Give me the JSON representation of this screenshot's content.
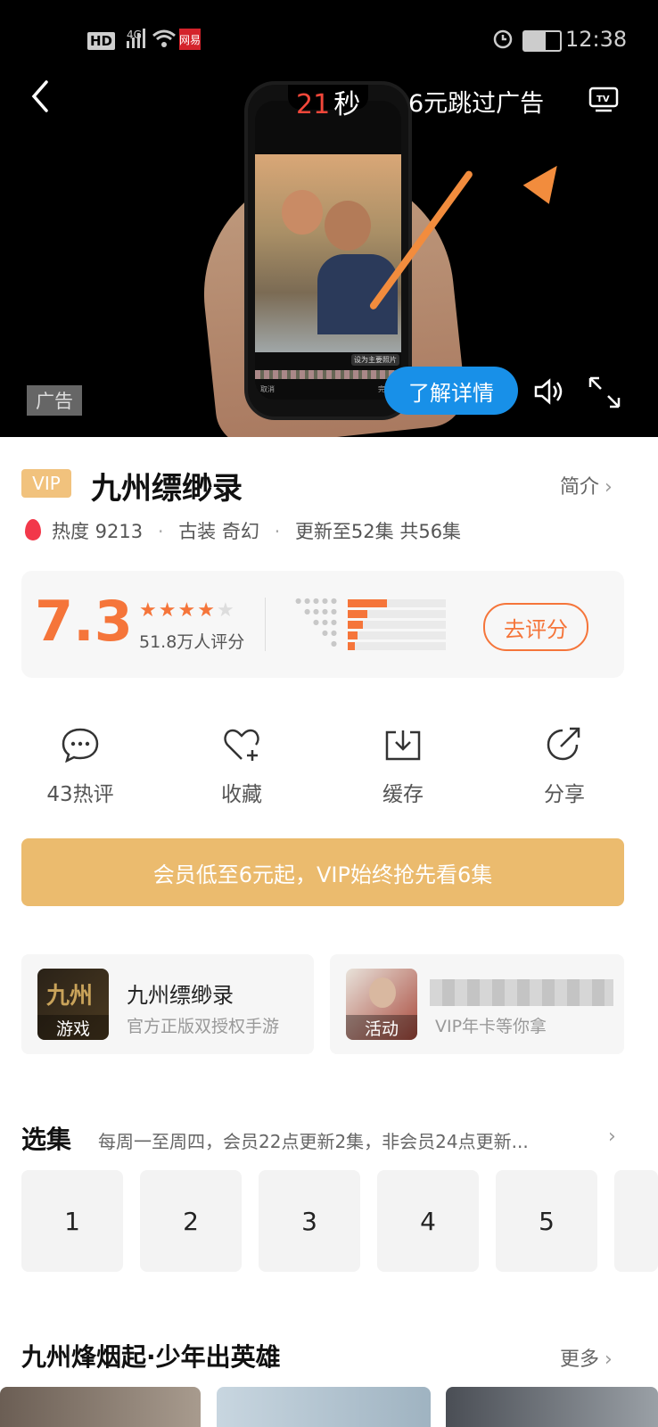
{
  "status_bar": {
    "network": "HD",
    "signal": "4G",
    "carrier_badge": "网易",
    "time": "12:38"
  },
  "ad": {
    "countdown_number": "21",
    "countdown_unit": "秒",
    "skip_text": "6元跳过广告",
    "tag": "广告",
    "learn_more": "了解详情",
    "phone_overlay_text": "设为主要照片",
    "phone_cancel": "取消",
    "phone_done": "完成"
  },
  "show": {
    "vip_badge": "VIP",
    "title": "九州缥缈录",
    "intro_link": "简介",
    "heat_label": "热度 9213",
    "genre": "古装 奇幻",
    "update": "更新至52集 共56集"
  },
  "rating": {
    "score": "7.3",
    "stars_value": 3.5,
    "count": "51.8万人评分",
    "rate_button": "去评分",
    "distribution": [
      0.4,
      0.2,
      0.15,
      0.1,
      0.07
    ]
  },
  "actions": [
    {
      "label": "43热评",
      "icon": "comment-icon"
    },
    {
      "label": "收藏",
      "icon": "heart-add-icon"
    },
    {
      "label": "缓存",
      "icon": "download-icon"
    },
    {
      "label": "分享",
      "icon": "share-icon"
    }
  ],
  "vip_banner": "会员低至6元起，VIP始终抢先看6集",
  "cards": [
    {
      "title": "九州缥缈录",
      "subtitle": "官方正版双授权手游",
      "tag": "游戏"
    },
    {
      "title": "",
      "subtitle": "VIP年卡等你拿",
      "tag": "活动"
    }
  ],
  "episodes": {
    "title": "选集",
    "desc": "每周一至周四，会员22点更新2集，非会员24点更新...",
    "items": [
      "1",
      "2",
      "3",
      "4",
      "5"
    ]
  },
  "related": {
    "title": "九州烽烟起·少年出英雄",
    "more": "更多"
  },
  "colors": {
    "accent": "#f5753a",
    "vip_gold": "#ebbb6e",
    "learn_blue": "#1890e8"
  }
}
